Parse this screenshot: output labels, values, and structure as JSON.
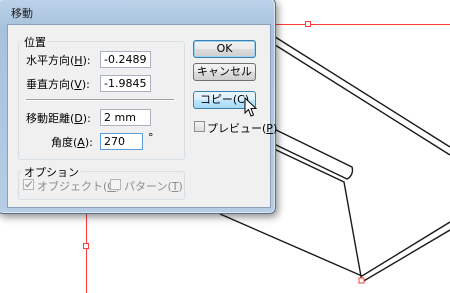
{
  "dialog": {
    "title": "移動"
  },
  "position_group": {
    "label": "位置",
    "horizontal": {
      "label_pre": "水平方向(",
      "accel": "H",
      "label_post": "):",
      "value": "-0.2489"
    },
    "vertical": {
      "label_pre": "垂直方向(",
      "accel": "V",
      "label_post": "):",
      "value": "-1.9845"
    },
    "distance": {
      "label_pre": "移動距離(",
      "accel": "D",
      "label_post": "):",
      "value": "2 mm"
    },
    "angle": {
      "label_pre": "角度(",
      "accel": "A",
      "label_post": "):",
      "value": "270",
      "unit": "°"
    }
  },
  "options_group": {
    "label": "オプション",
    "objects": {
      "label_pre": "オブジェクト(",
      "accel": "O",
      "label_post": ")",
      "checked": true,
      "enabled": false
    },
    "patterns": {
      "label_pre": "パターン(",
      "accel": "T",
      "label_post": ")",
      "checked": false,
      "enabled": false
    }
  },
  "buttons": {
    "ok": "OK",
    "cancel": "キャンセル",
    "copy": "コピー(C)"
  },
  "preview": {
    "label_pre": "プレビュー(",
    "accel": "P",
    "label_post": ")",
    "checked": false
  },
  "colors": {
    "selection": "#ff3b3b",
    "path": "#1a1a1a"
  }
}
